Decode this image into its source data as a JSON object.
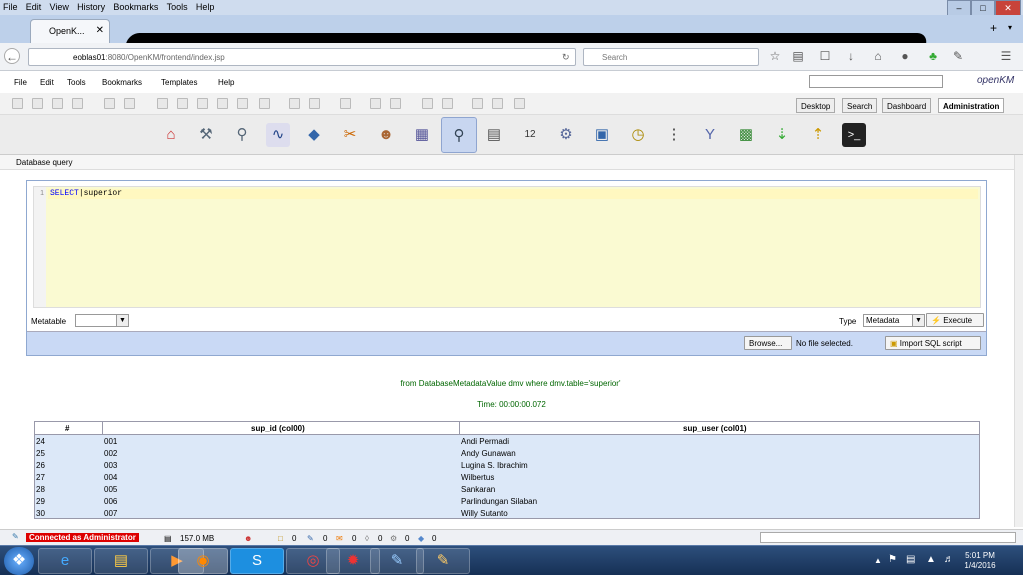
{
  "firefox": {
    "menu": [
      "File",
      "Edit",
      "View",
      "History",
      "Bookmarks",
      "Tools",
      "Help"
    ],
    "tab_title": "OpenK...",
    "url_host": "eoblas01",
    "url_rest": ":8080/OpenKM/frontend/index.jsp",
    "search_placeholder": "Search"
  },
  "okm": {
    "menu": [
      "File",
      "Edit",
      "Tools",
      "Bookmarks",
      "Templates",
      "Help"
    ],
    "logo": "openKM",
    "workspace_tabs": [
      "Desktop",
      "Search",
      "Dashboard",
      "Administration"
    ],
    "active_tab": "Administration",
    "section_title": "Database query",
    "admin_icons": [
      "home-icon",
      "tools-icon",
      "search-doc-icon",
      "monitor-icon",
      "diamond-icon",
      "scissors-icon",
      "users-icon",
      "files-icon",
      "database-query-icon",
      "scanner-icon",
      "calendar-icon",
      "gear-icon",
      "window-icon",
      "clock-icon",
      "list-icon",
      "filter-icon",
      "books-icon",
      "import-icon",
      "export-icon",
      "terminal-icon"
    ],
    "selected_admin_icon": "database-query-icon"
  },
  "query": {
    "line_number": "1",
    "keyword": "SELECT",
    "code": "superior",
    "metatable_label": "Metatable",
    "metatable_value": "",
    "type_label": "Type",
    "type_value": "Metadata",
    "execute_label": "Execute",
    "browse_label": "Browse...",
    "file_status": "No file selected.",
    "import_label": "Import SQL script"
  },
  "result": {
    "sql": "from DatabaseMetadataValue dmv where dmv.table='superior'",
    "time": "Time: 00:00:00.072",
    "columns": [
      "#",
      "sup_id (col00)",
      "sup_user (col01)"
    ],
    "rows": [
      [
        "24",
        "001",
        "Andi Permadi"
      ],
      [
        "25",
        "002",
        "Andy Gunawan"
      ],
      [
        "26",
        "003",
        "Lugina S. Ibrachim"
      ],
      [
        "27",
        "004",
        "Wilbertus"
      ],
      [
        "28",
        "005",
        "Sankaran"
      ],
      [
        "29",
        "006",
        "Parlindungan Silaban"
      ],
      [
        "30",
        "007",
        "Willy Sutanto"
      ]
    ]
  },
  "status": {
    "connected": "Connected as Administrator",
    "memory": "157.0 MB",
    "counts": [
      "0",
      "0",
      "0",
      "0",
      "0",
      "0"
    ]
  },
  "taskbar": {
    "time": "5:01 PM",
    "date": "1/4/2016"
  },
  "colors": {
    "editor_bg": "#fafad2",
    "result_bg": "#dce8f8",
    "accent": "#8fa8d0",
    "status_red": "#dd0000",
    "success_green": "#006600"
  }
}
